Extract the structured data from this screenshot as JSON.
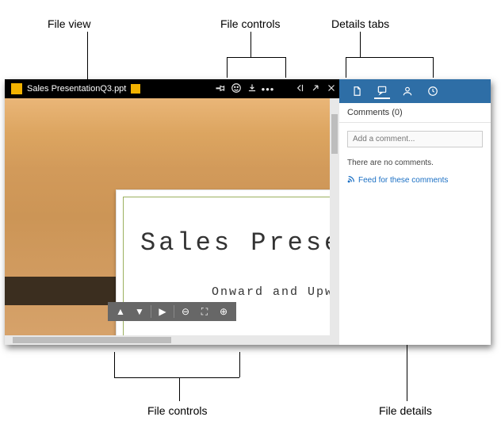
{
  "annotations": {
    "file_view": "File view",
    "file_controls_top": "File controls",
    "details_tabs": "Details tabs",
    "file_controls_bottom": "File controls",
    "file_details": "File details"
  },
  "topbar": {
    "file_title": "Sales PresentationQ3.ppt",
    "icons": {
      "pin": "pin-icon",
      "emoji": "emoji-icon",
      "download": "download-icon",
      "more": "more-icon",
      "collapse": "collapse-icon",
      "expand": "expand-icon",
      "close": "close-icon"
    }
  },
  "slide": {
    "title": "Sales Prese",
    "subtitle": "Onward and Upw"
  },
  "bottom_controls": {
    "prev": "▲",
    "next": "▼",
    "play": "▶",
    "zoom_out": "⊖",
    "fit": "⛶",
    "zoom_in": "⊕"
  },
  "details": {
    "tabs": {
      "file": "file-tab",
      "comments": "comments-tab",
      "user": "user-tab",
      "history": "history-tab"
    },
    "section_header": "Comments (0)",
    "input_placeholder": "Add a comment...",
    "empty_msg": "There are no comments.",
    "feed_link": "Feed for these comments"
  }
}
